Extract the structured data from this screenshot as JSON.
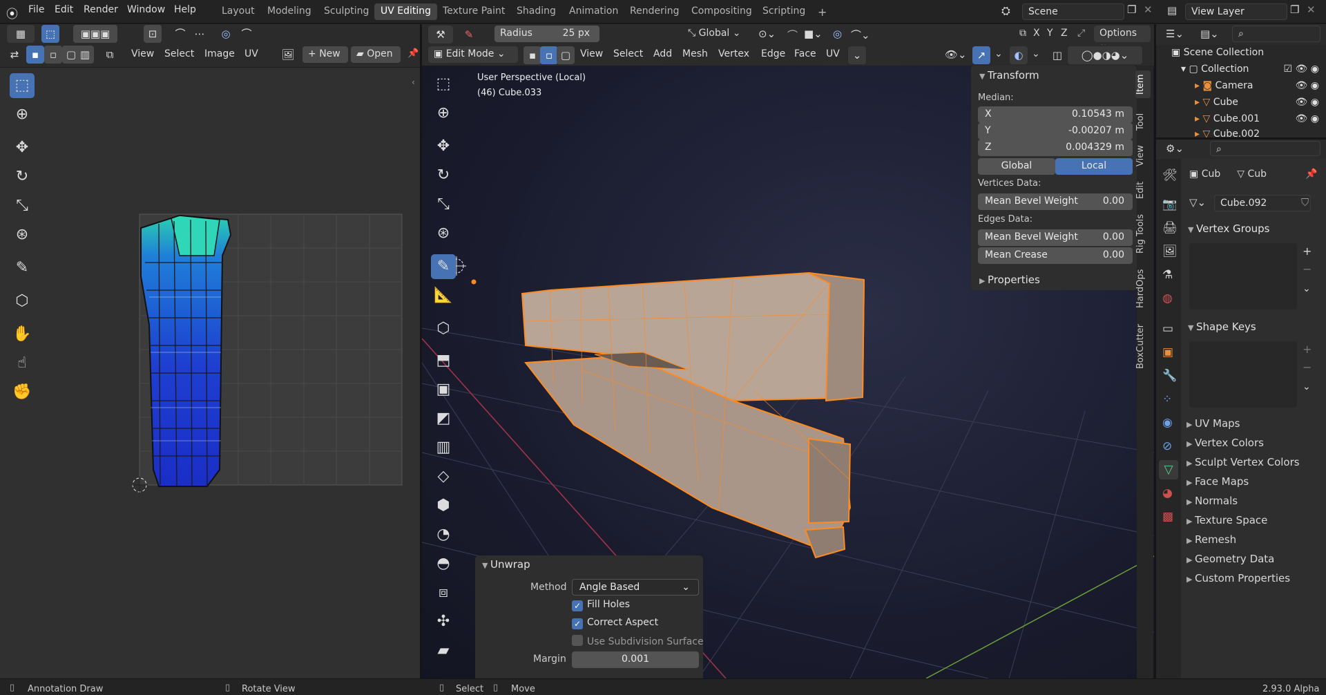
{
  "topbar": {
    "menus": [
      "File",
      "Edit",
      "Render",
      "Window",
      "Help"
    ],
    "workspaces": [
      "Layout",
      "Modeling",
      "Sculpting",
      "UV Editing",
      "Texture Paint",
      "Shading",
      "Animation",
      "Rendering",
      "Compositing",
      "Scripting"
    ],
    "active_workspace": "UV Editing",
    "add_tab": "+",
    "scene_label": "Scene",
    "view_layer_label": "View Layer"
  },
  "uv_editor": {
    "menus": [
      "View",
      "Select",
      "Image",
      "UV"
    ],
    "new_label": "New",
    "open_label": "Open"
  },
  "viewport": {
    "radius_label": "Radius",
    "radius_value": "25 px",
    "orientation": "Global",
    "axes": [
      "X",
      "Y",
      "Z"
    ],
    "options_label": "Options",
    "mode": "Edit Mode",
    "menus": [
      "View",
      "Select",
      "Add",
      "Mesh",
      "Vertex",
      "Edge",
      "Face",
      "UV"
    ],
    "perspective_text": "User Perspective (Local)",
    "object_text": "(46) Cube.033"
  },
  "transform_panel": {
    "title": "Transform",
    "median_label": "Median:",
    "x_label": "X",
    "x_value": "0.10543 m",
    "y_label": "Y",
    "y_value": "-0.00207 m",
    "z_label": "Z",
    "z_value": "0.004329 m",
    "global_label": "Global",
    "local_label": "Local",
    "vertices_data_label": "Vertices Data:",
    "mean_bevel_weight_label": "Mean Bevel Weight",
    "vertex_bevel_value": "0.00",
    "edges_data_label": "Edges Data:",
    "edge_bevel_value": "0.00",
    "mean_crease_label": "Mean Crease",
    "crease_value": "0.00",
    "properties_label": "Properties"
  },
  "side_tabs": [
    "Item",
    "Tool",
    "View",
    "Edit",
    "Rig Tools",
    "HardOps",
    "BoxCutter"
  ],
  "unwrap_panel": {
    "title": "Unwrap",
    "method_label": "Method",
    "method_value": "Angle Based",
    "fill_holes": "Fill Holes",
    "correct_aspect": "Correct Aspect",
    "use_subdivision": "Use Subdivision Surface",
    "margin_label": "Margin",
    "margin_value": "0.001"
  },
  "outliner": {
    "scene_collection": "Scene Collection",
    "items": [
      "Collection",
      "Camera",
      "Cube",
      "Cube.001",
      "Cube.002"
    ]
  },
  "properties": {
    "breadcrumb_obj": "Cub",
    "breadcrumb_mesh": "Cub",
    "mesh_name": "Cube.092",
    "vertex_groups": "Vertex Groups",
    "shape_keys": "Shape Keys",
    "collapsed": [
      "UV Maps",
      "Vertex Colors",
      "Sculpt Vertex Colors",
      "Face Maps",
      "Normals",
      "Texture Space",
      "Remesh",
      "Geometry Data",
      "Custom Properties"
    ]
  },
  "statusbar": {
    "annotation": "Annotation Draw",
    "rotate": "Rotate View",
    "select": "Select",
    "move": "Move",
    "version": "2.93.0 Alpha"
  },
  "colors": {
    "accent": "#4772b3",
    "selection_orange": "#ff8a1f",
    "mesh_face": "#b8a597"
  }
}
